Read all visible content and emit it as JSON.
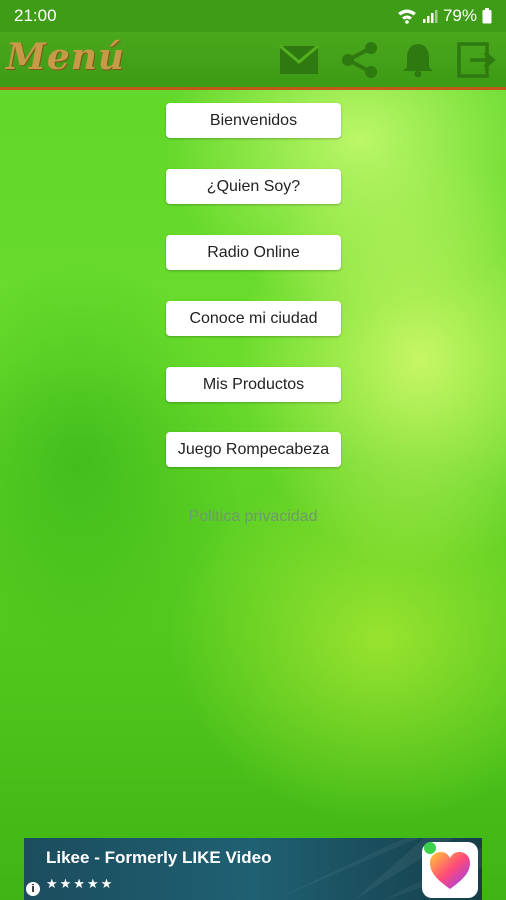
{
  "status_bar": {
    "time": "21:00",
    "battery": "79%"
  },
  "app_bar": {
    "title": "Menú",
    "icons": [
      "mail-icon",
      "share-icon",
      "bell-icon",
      "exit-icon"
    ]
  },
  "menu": {
    "buttons": [
      {
        "label": "Bienvenidos"
      },
      {
        "label": "¿Quien Soy?"
      },
      {
        "label": "Radio Online"
      },
      {
        "label": "Conoce mi ciudad"
      },
      {
        "label": "Mis Productos"
      },
      {
        "label": "Juego Rompecabeza"
      }
    ],
    "policy_link": "Politica privacidad"
  },
  "ad": {
    "title": "Likee - Formerly LIKE Video",
    "rating": "★★★★★",
    "info": "i"
  }
}
